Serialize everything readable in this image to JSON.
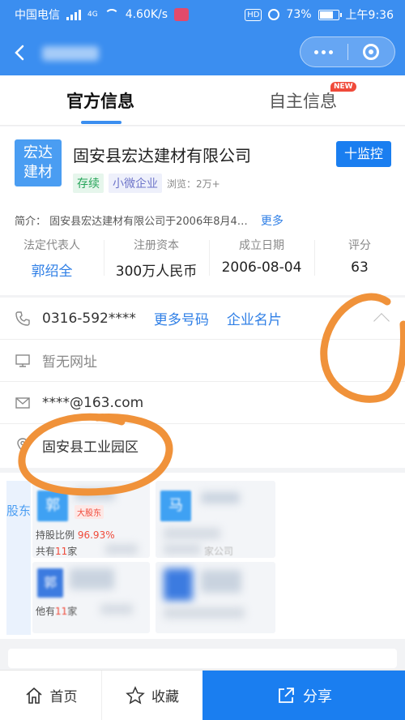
{
  "status_bar": {
    "carrier": "中国电信",
    "net": "4G",
    "speed": "4.60K/s",
    "battery": "73%",
    "time": "上午9:36"
  },
  "tabs": [
    {
      "label": "官方信息",
      "active": true
    },
    {
      "label": "自主信息",
      "badge": "NEW"
    }
  ],
  "company": {
    "logo_line1": "宏达",
    "logo_line2": "建材",
    "name": "固安县宏达建材有限公司",
    "monitor_label": "十监控",
    "status_tag": "存续",
    "size_tag": "小微企业",
    "views": "浏览：2万+",
    "intro": "简介：  固安县宏达建材有限公司于2006年8月4…",
    "intro_more": "更多"
  },
  "stats": [
    {
      "label": "法定代表人",
      "value": "郭绍全"
    },
    {
      "label": "注册资本",
      "value": "300万人民币"
    },
    {
      "label": "成立日期",
      "value": "2006-08-04"
    },
    {
      "label": "评分",
      "value": "63"
    }
  ],
  "contact": {
    "phone": "0316-592****",
    "more_numbers": "更多号码",
    "business_card": "企业名片",
    "website": "暂无网址",
    "email": "****@163.com",
    "address": "固安县工业园区"
  },
  "shareholders": {
    "side_label": "股东",
    "card1_avatar": "郭",
    "card1_tag": "大股东",
    "card1_ratio_label": "持股比例",
    "card1_ratio": "96.93%",
    "card1_count_pre": "共有",
    "card1_count": "11",
    "card1_count_post": "家",
    "card2_avatar": "马",
    "card2_text": "家公司",
    "card3_avatar": "郭",
    "card3_pre": "他有",
    "card3_count": "11",
    "card3_post": "家"
  },
  "bottom_bar": {
    "home": "首页",
    "favorite": "收藏",
    "share": "分享"
  },
  "colors": {
    "brand_blue": "#3b8ef0",
    "button_blue": "#1a7ef0",
    "annotation_orange": "#f0923a"
  }
}
